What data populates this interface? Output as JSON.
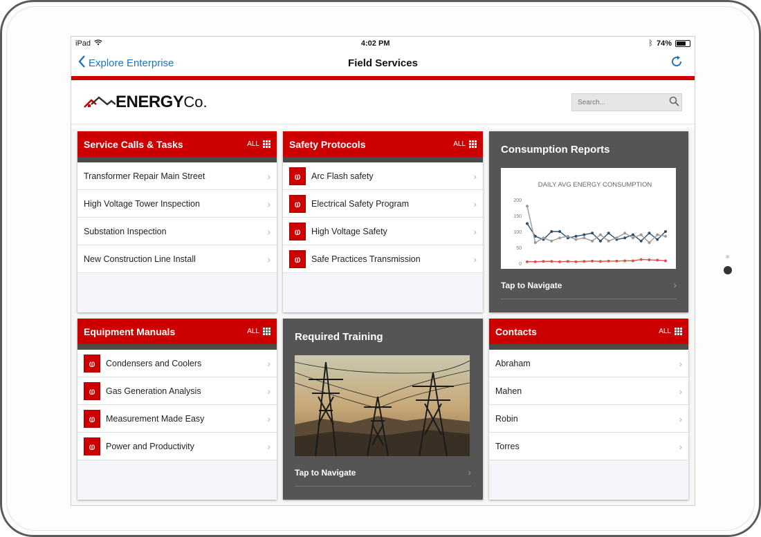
{
  "status_bar": {
    "device": "iPad",
    "time": "4:02 PM",
    "battery": "74%",
    "battery_level": 0.74
  },
  "nav": {
    "back_label": "Explore Enterprise",
    "title": "Field Services"
  },
  "brand": {
    "logo_strong": "ENERGY",
    "logo_light": "Co."
  },
  "search": {
    "placeholder": "Search..."
  },
  "colors": {
    "brand_red": "#cc0000",
    "ios_blue": "#1e73be",
    "dark_card": "#555555"
  },
  "service_calls": {
    "title": "Service Calls & Tasks",
    "all_label": "ALL",
    "items": [
      "Transformer Repair Main Street",
      "High Voltage Tower Inspection",
      "Substation Inspection",
      "New Construction Line Install"
    ]
  },
  "safety": {
    "title": "Safety Protocols",
    "all_label": "ALL",
    "items": [
      "Arc Flash safety",
      "Electrical Safety Program",
      "High Voltage Safety",
      "Safe Practices Transmission"
    ]
  },
  "consumption": {
    "title": "Consumption Reports",
    "tap_label": "Tap to Navigate"
  },
  "equipment": {
    "title": "Equipment Manuals",
    "all_label": "ALL",
    "items": [
      "Condensers and Coolers",
      "Gas Generation Analysis",
      "Measurement Made Easy",
      "Power and Productivity"
    ]
  },
  "training": {
    "title": "Required Training",
    "tap_label": "Tap to Navigate"
  },
  "contacts": {
    "title": "Contacts",
    "all_label": "ALL",
    "items": [
      "Abraham",
      "Mahen",
      "Robin",
      "Torres"
    ]
  },
  "chart_data": {
    "type": "line",
    "title": "DAILY AVG ENERGY CONSUMPTION",
    "xlabel": "",
    "ylabel": "",
    "ylim": [
      0,
      200
    ],
    "yticks": [
      "0",
      "50",
      "100",
      "150",
      "200"
    ],
    "grid": false,
    "series": [
      {
        "values": [
          125,
          85,
          75,
          100,
          100,
          80,
          85,
          90,
          95,
          70,
          95,
          75,
          80,
          90,
          70,
          95,
          75,
          100
        ],
        "color": "#2c4f6e"
      },
      {
        "values": [
          180,
          65,
          80,
          70,
          80,
          85,
          75,
          80,
          70,
          90,
          70,
          80,
          95,
          80,
          90,
          65,
          90,
          85
        ],
        "color": "#9a9a9a"
      },
      {
        "values": [
          5,
          5,
          6,
          6,
          5,
          6,
          5,
          6,
          7,
          6,
          7,
          7,
          8,
          8,
          12,
          11,
          10,
          8
        ],
        "color": "#d9534f"
      }
    ]
  }
}
